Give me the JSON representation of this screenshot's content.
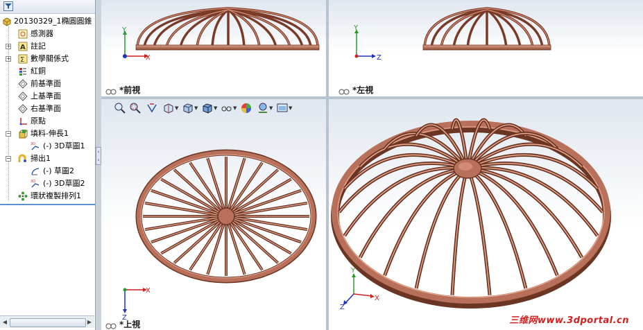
{
  "tree": {
    "filter_icon": "funnel-icon",
    "items": [
      {
        "label": "20130329_1橢圓圓錐",
        "icon": "part-icon"
      },
      {
        "label": "感測器",
        "icon": "sensor-icon"
      },
      {
        "label": "註記",
        "icon": "annotation-icon"
      },
      {
        "label": "數學關係式",
        "icon": "equations-icon"
      },
      {
        "label": "紅銅",
        "icon": "material-icon"
      },
      {
        "label": "前基準面",
        "icon": "plane-icon"
      },
      {
        "label": "上基準面",
        "icon": "plane-icon"
      },
      {
        "label": "右基準面",
        "icon": "plane-icon"
      },
      {
        "label": "原點",
        "icon": "origin-icon"
      },
      {
        "label": "填料-伸長1",
        "icon": "extrude-icon"
      },
      {
        "label": "(-) 3D草圖1",
        "icon": "sketch3d-icon"
      },
      {
        "label": "掃出1",
        "icon": "sweep-icon"
      },
      {
        "label": "(-) 草圖2",
        "icon": "sketch-icon"
      },
      {
        "label": "(-) 3D草圖2",
        "icon": "sketch3d-icon"
      },
      {
        "label": "環狀複製排列1",
        "icon": "circular-pattern-icon"
      }
    ]
  },
  "viewports": {
    "front": {
      "label": "*前視"
    },
    "left": {
      "label": "*左視"
    },
    "top": {
      "label": "*上視"
    },
    "iso": {
      "label": ""
    }
  },
  "axes": {
    "x": "X",
    "y": "Y",
    "z": "Z"
  },
  "hud_icons": [
    "zoom-to-fit-icon",
    "zoom-area-icon",
    "previous-view-icon",
    "section-view-icon",
    "view-orientation-icon",
    "display-style-icon",
    "hide-show-icon",
    "edit-appearance-icon",
    "apply-scene-icon",
    "view-settings-icon"
  ],
  "watermark": "三维网www.3dportal.cn",
  "colors": {
    "copper": "#b8705a",
    "copper_dark": "#6b3524",
    "copper_light": "#e8a890"
  }
}
